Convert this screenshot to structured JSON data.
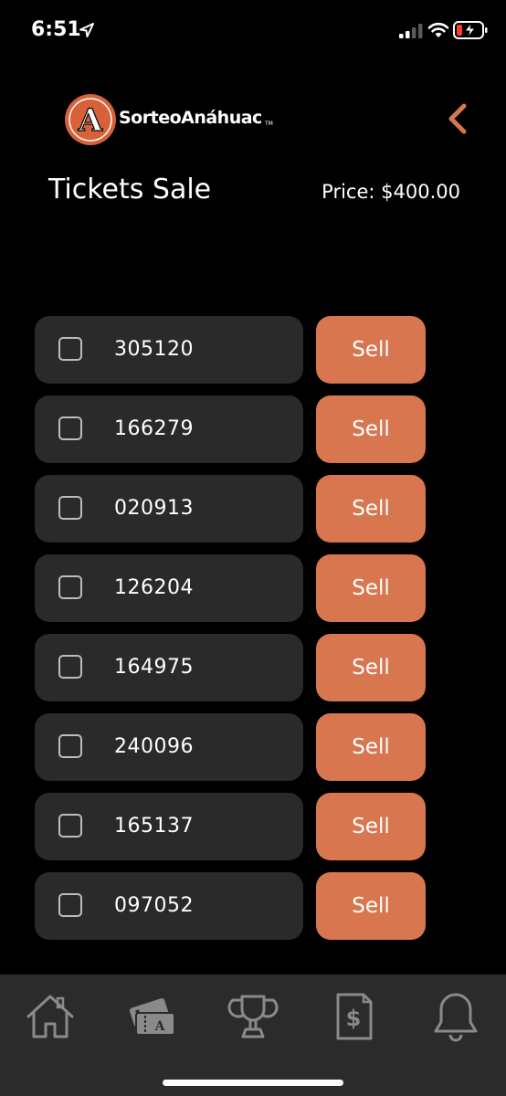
{
  "status_bar": {
    "time": "6:51"
  },
  "header": {
    "logo_text": "SorteoAnáhuac",
    "logo_letter": "A",
    "logo_tm": "TM",
    "title": "Tickets Sale",
    "price": "Price: $400.00"
  },
  "tickets": [
    {
      "number": "305120",
      "sell_label": "Sell"
    },
    {
      "number": "166279",
      "sell_label": "Sell"
    },
    {
      "number": "020913",
      "sell_label": "Sell"
    },
    {
      "number": "126204",
      "sell_label": "Sell"
    },
    {
      "number": "164975",
      "sell_label": "Sell"
    },
    {
      "number": "240096",
      "sell_label": "Sell"
    },
    {
      "number": "165137",
      "sell_label": "Sell"
    },
    {
      "number": "097052",
      "sell_label": "Sell"
    }
  ],
  "tab_bar": {
    "items": [
      {
        "icon": "home-icon"
      },
      {
        "icon": "tickets-icon",
        "letter": "A"
      },
      {
        "icon": "trophy-icon"
      },
      {
        "icon": "receipt-dollar-icon",
        "symbol": "$"
      },
      {
        "icon": "bell-icon"
      }
    ]
  },
  "colors": {
    "accent": "#d87650",
    "card": "#2a2a2a",
    "tab_bar": "#2b2b2b",
    "background": "#000000",
    "icon_muted": "#8a8a8a"
  }
}
